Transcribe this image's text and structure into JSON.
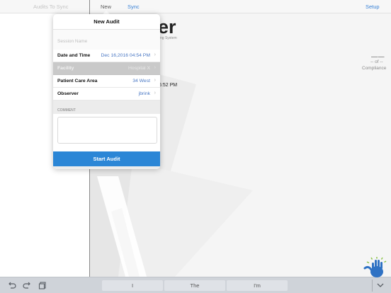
{
  "topbar": {
    "audits_to_sync": "Audits To Sync",
    "new_tab": "New",
    "sync_tab": "Sync",
    "setup": "Setup"
  },
  "background": {
    "title_fragment": "er",
    "subtitle_fragment": "ng System",
    "dashes": "——",
    "count_text": "-- of --",
    "compliance": "Compliance",
    "time_fragment": "6:52 PM"
  },
  "popover": {
    "title": "New Audit",
    "session_placeholder": "Session Name",
    "session_value": "",
    "rows": [
      {
        "label": "Date and Time",
        "value": "Dec 16,2016 04:54 PM"
      },
      {
        "label": "Facility",
        "value": "Hospital X"
      },
      {
        "label": "Patient Care Area",
        "value": "34 West"
      },
      {
        "label": "Observer",
        "value": "jbrink"
      }
    ],
    "comment_label": "COMMENT",
    "comment_value": "",
    "start_button": "Start Audit"
  },
  "keyboard": {
    "suggestions": [
      "I",
      "The",
      "I'm"
    ]
  },
  "colors": {
    "accent": "#2b86d6",
    "link": "#3a82d6",
    "value_text": "#4a78c4",
    "disabled_row": "#c9c9c9"
  }
}
